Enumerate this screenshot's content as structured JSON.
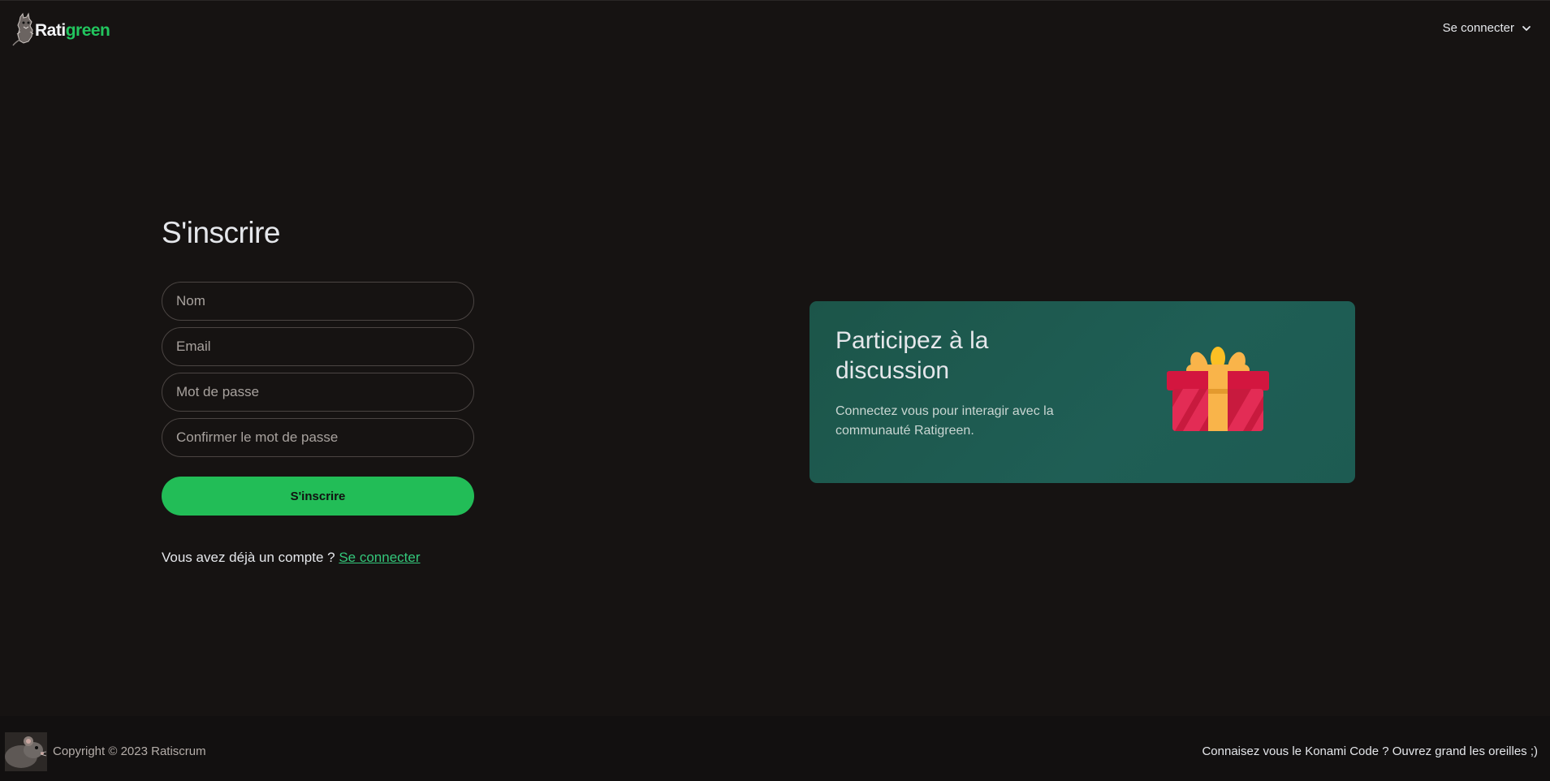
{
  "header": {
    "logo": {
      "text_white": "Rati",
      "text_green": "green",
      "icon": "rat-mascot-icon"
    },
    "login_menu": {
      "label": "Se connecter",
      "icon": "chevron-down-icon"
    }
  },
  "signup": {
    "title": "S'inscrire",
    "fields": {
      "name": {
        "placeholder": "Nom",
        "value": ""
      },
      "email": {
        "placeholder": "Email",
        "value": ""
      },
      "password": {
        "placeholder": "Mot de passe",
        "value": ""
      },
      "confirm_password": {
        "placeholder": "Confirmer le mot de passe",
        "value": ""
      }
    },
    "submit_label": "S'inscrire",
    "already_text": "Vous avez déjà un compte ? ",
    "login_link": "Se connecter"
  },
  "promo": {
    "title": "Participez à la discussion",
    "text": "Connectez vous pour interagir avec la communauté Ratigreen.",
    "icon": "gift-icon"
  },
  "footer": {
    "copyright": "Copyright © 2023 Ratiscrum",
    "konami": "Connaisez vous le Konami Code ? Ouvrez grand les oreilles ;)",
    "icon": "rat-photo-icon"
  },
  "colors": {
    "background": "#161312",
    "accent_green": "#22bd57",
    "link_green": "#34c77b",
    "card_teal": "#1f5e55",
    "gift_red": "#d3163f",
    "gift_ribbon": "#f9b44a"
  }
}
